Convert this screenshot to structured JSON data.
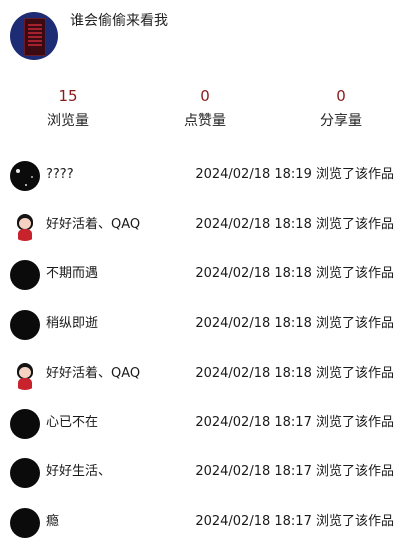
{
  "header": {
    "title": "谁会偷偷来看我",
    "avatar_icon": "poster-avatar-icon"
  },
  "stats": {
    "views": {
      "value": "15",
      "label": "浏览量"
    },
    "likes": {
      "value": "0",
      "label": "点赞量"
    },
    "shares": {
      "value": "0",
      "label": "分享量"
    }
  },
  "colors": {
    "stat_number": "#8b1a1a",
    "text": "#1a1a1a",
    "background": "#ffffff"
  },
  "visitors": [
    {
      "name": "????",
      "time": "2024/02/18 18:19",
      "action": "浏览了该作品",
      "avatar": "dark-starry-avatar-icon"
    },
    {
      "name": "好好活着、QAQ",
      "time": "2024/02/18 18:18",
      "action": "浏览了该作品",
      "avatar": "cartoon-girl-avatar-icon"
    },
    {
      "name": "不期而遇",
      "time": "2024/02/18 18:18",
      "action": "浏览了该作品",
      "avatar": "dark-avatar-icon"
    },
    {
      "name": "稍纵即逝",
      "time": "2024/02/18 18:18",
      "action": "浏览了该作品",
      "avatar": "dark-avatar-icon"
    },
    {
      "name": "好好活着、QAQ",
      "time": "2024/02/18 18:18",
      "action": "浏览了该作品",
      "avatar": "cartoon-girl-avatar-icon"
    },
    {
      "name": "心已不在",
      "time": "2024/02/18 18:17",
      "action": "浏览了该作品",
      "avatar": "dark-avatar-icon"
    },
    {
      "name": "好好生活、",
      "time": "2024/02/18 18:17",
      "action": "浏览了该作品",
      "avatar": "dark-avatar-icon"
    },
    {
      "name": "瘾",
      "time": "2024/02/18 18:17",
      "action": "浏览了该作品",
      "avatar": "dark-avatar-icon"
    }
  ]
}
